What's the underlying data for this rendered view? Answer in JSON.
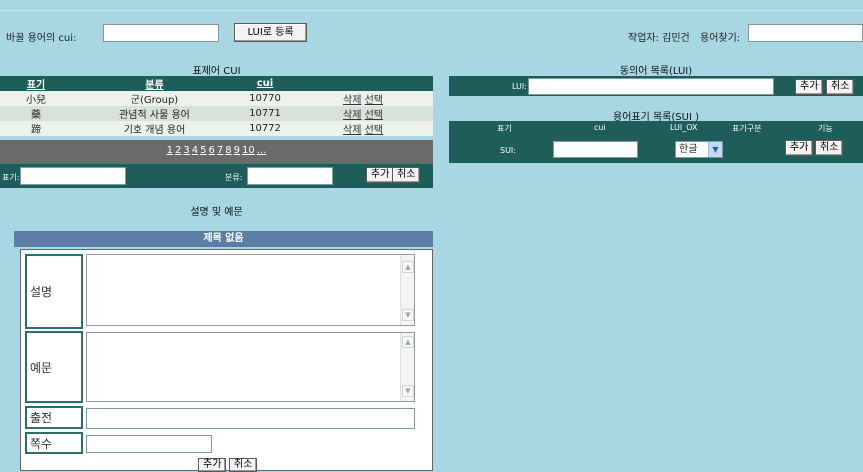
{
  "top": {
    "replace_label": "바꿀 용어의 cui:",
    "replace_value": "",
    "register_button": "LUI로 등록",
    "worker_label": "작업자: 김민건",
    "search_label": "용어찾기:",
    "search_value": ""
  },
  "left": {
    "title": "표제어 CUI",
    "columns": [
      "표기",
      "분류",
      "cui"
    ],
    "rows": [
      {
        "term": "小兒",
        "category": "군(Group)",
        "cui": "10770",
        "delete": "삭제",
        "select": "선택"
      },
      {
        "term": "藥",
        "category": "관념적 사물 용어",
        "cui": "10771",
        "delete": "삭제",
        "select": "선택"
      },
      {
        "term": "蹄",
        "category": "기호 개념 용어",
        "cui": "10772",
        "delete": "삭제",
        "select": "선택"
      }
    ],
    "pages": [
      "1",
      "2",
      "3",
      "4",
      "5",
      "6",
      "7",
      "8",
      "9",
      "10",
      "..."
    ],
    "form": {
      "notation_label": "표기:",
      "category_label": "분류:",
      "add_button": "추가",
      "cancel_button": "취소"
    },
    "desc_title": "설명 및 예문",
    "no_title": "제목 없음",
    "desc_label": "설명",
    "example_label": "예문",
    "source_label": "출전",
    "page_label": "쪽수",
    "bottom_add": "추가",
    "bottom_cancel": "취소"
  },
  "right": {
    "title": "동의어 목록(LUI)",
    "lui_label": "LUI:",
    "lui_add": "추가",
    "lui_cancel": "취소",
    "sui_title": "용어표기 목록(SUI )",
    "sui_columns": [
      "표기",
      "cui",
      "LUI_OX",
      "표기구분",
      "기능"
    ],
    "sui_label": "SUI:",
    "lang_value": "한글",
    "sui_add": "추가",
    "sui_cancel": "취소"
  },
  "colors": {
    "background": "#a8d6e3",
    "dark_teal": "#1f5d5a",
    "header_blue": "#5c7ea6",
    "pager_gray": "#6a6a6a"
  }
}
